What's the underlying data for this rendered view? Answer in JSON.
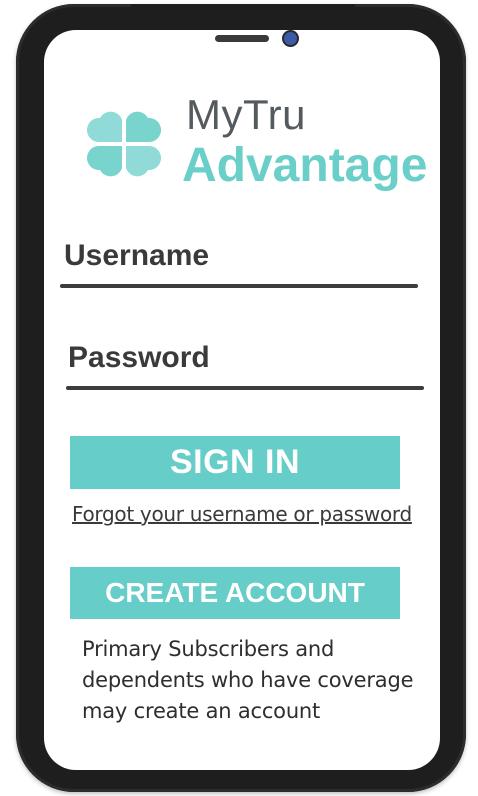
{
  "logo": {
    "line1": "MyTru",
    "line2": "Advantage",
    "icon": "four-leaf-heart-logo-icon",
    "accent_color": "#6bcfc9"
  },
  "form": {
    "username_label": "Username",
    "password_label": "Password"
  },
  "actions": {
    "sign_in_label": "SIGN IN",
    "forgot_link": "Forgot your username or password",
    "create_account_label": "CREATE ACCOUNT"
  },
  "note": {
    "text": "Primary Subscribers and dependents who have coverage may create an account"
  },
  "colors": {
    "button": "#66cdc8",
    "text_dark": "#3a3a3a",
    "frame": "#1e1e1e"
  }
}
